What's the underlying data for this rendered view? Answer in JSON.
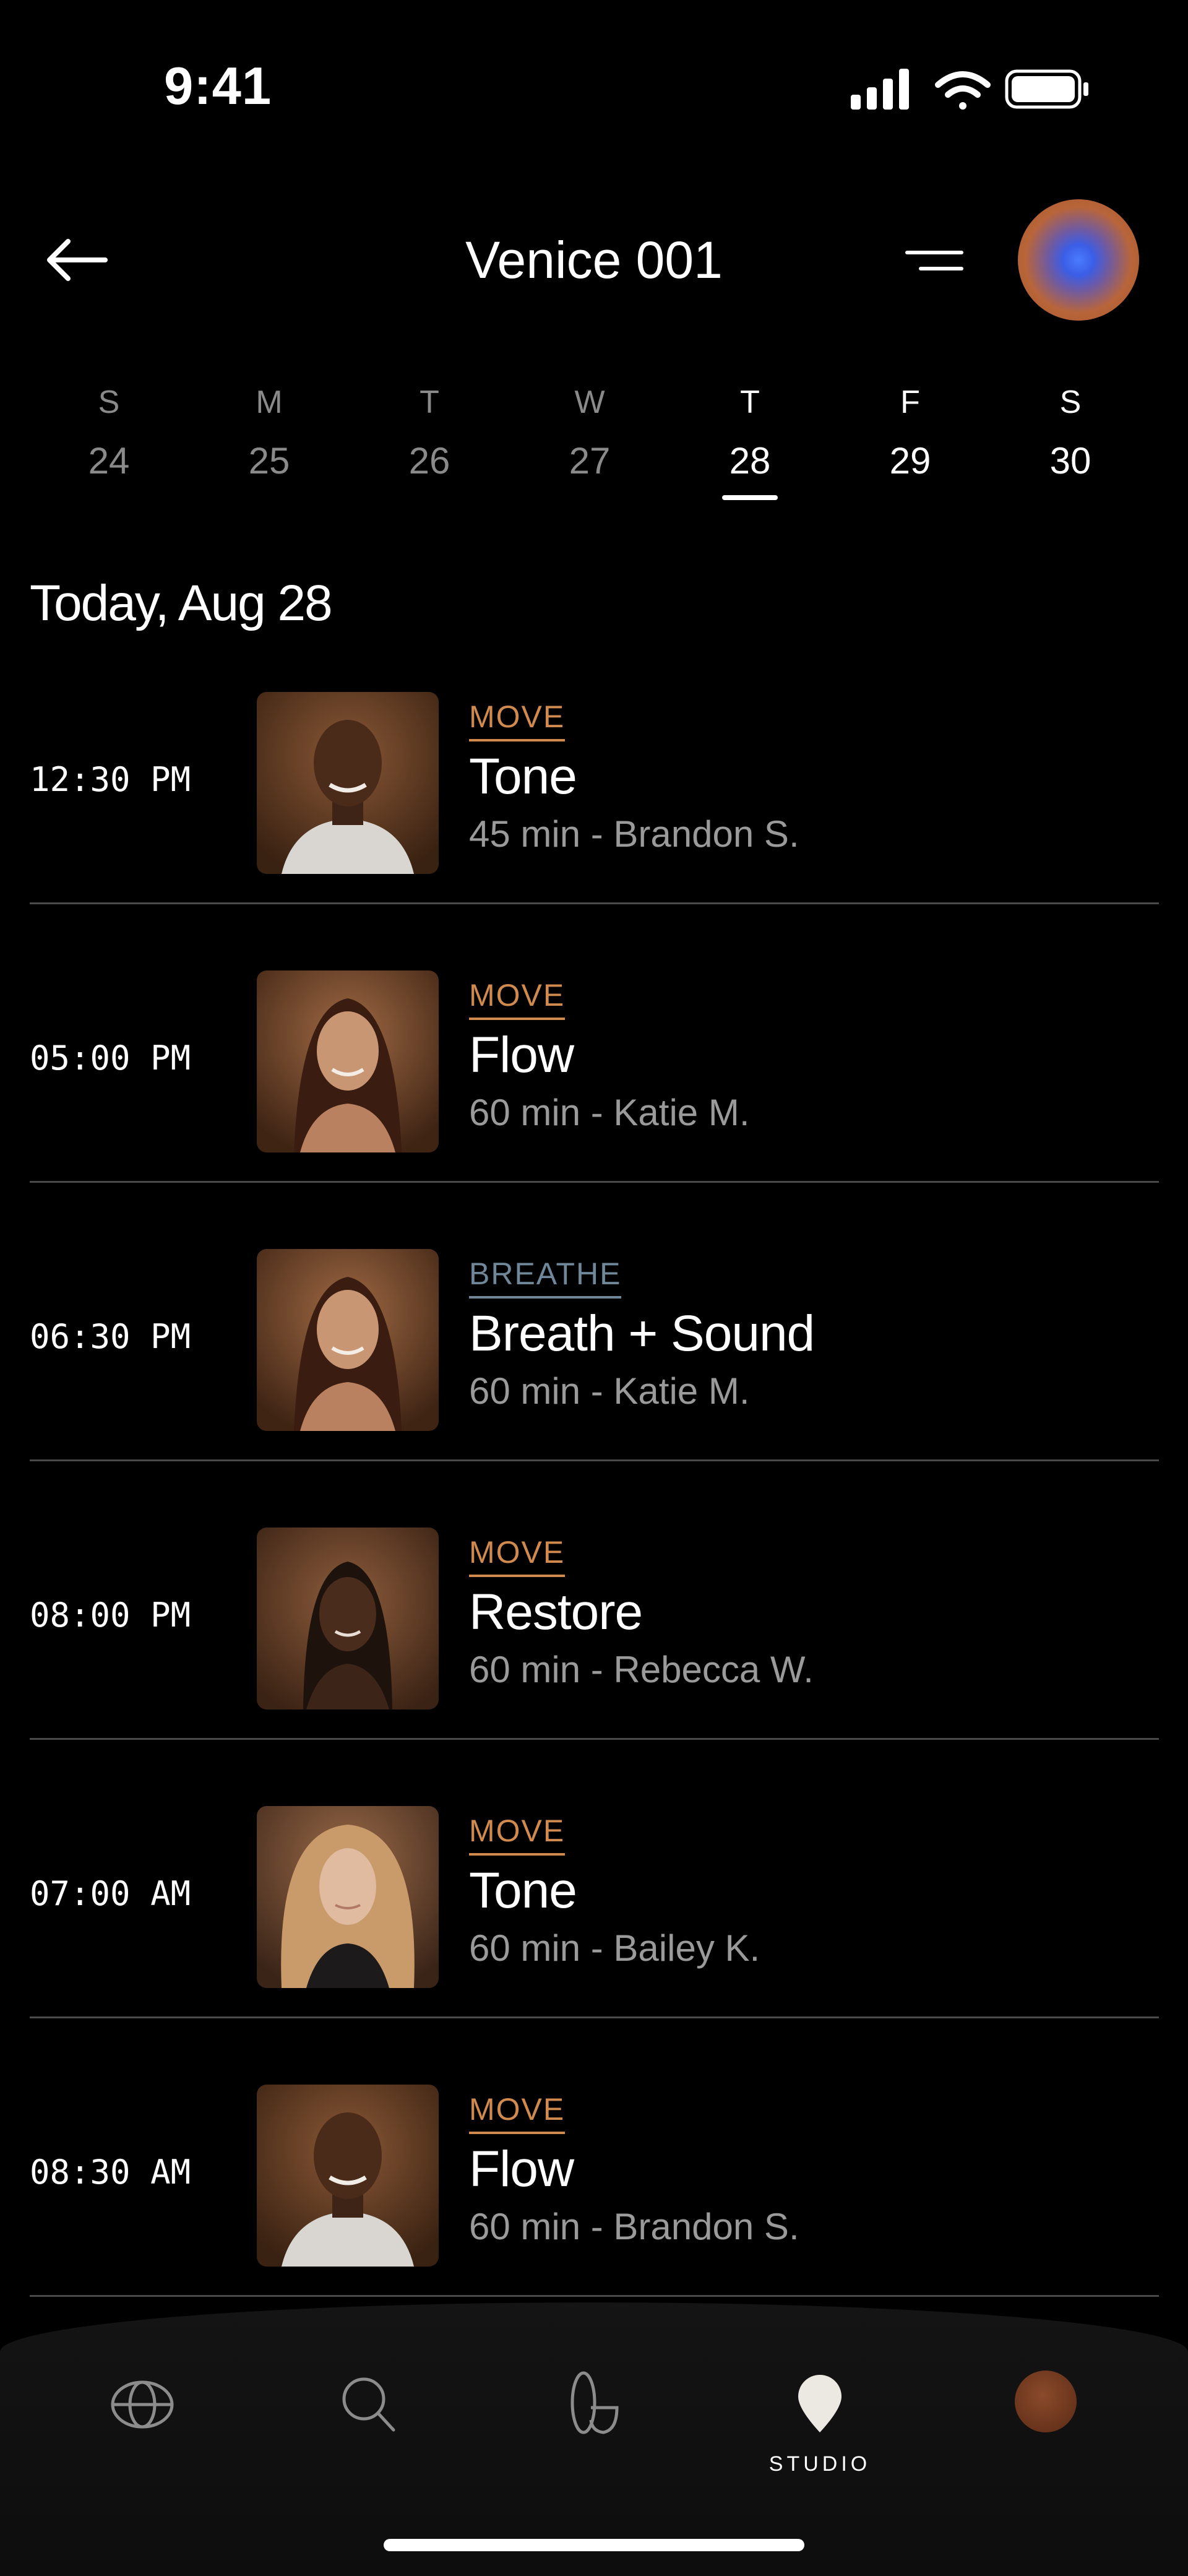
{
  "status_bar": {
    "time": "9:41",
    "icons": [
      "cellular-signal-icon",
      "wifi-icon",
      "battery-icon"
    ]
  },
  "header": {
    "title": "Venice 001",
    "back_icon": "arrow-left-icon",
    "filter_icon": "filter-lines-icon"
  },
  "week": {
    "days": [
      {
        "letter": "S",
        "date": "24",
        "state": "past"
      },
      {
        "letter": "M",
        "date": "25",
        "state": "past"
      },
      {
        "letter": "T",
        "date": "26",
        "state": "past"
      },
      {
        "letter": "W",
        "date": "27",
        "state": "past"
      },
      {
        "letter": "T",
        "date": "28",
        "state": "selected"
      },
      {
        "letter": "F",
        "date": "29",
        "state": "future"
      },
      {
        "letter": "S",
        "date": "30",
        "state": "future"
      }
    ]
  },
  "date_heading": "Today, Aug 28",
  "classes": [
    {
      "time": "12:30 PM",
      "category": "MOVE",
      "name": "Tone",
      "meta": "45 min - Brandon S."
    },
    {
      "time": "05:00 PM",
      "category": "MOVE",
      "name": "Flow",
      "meta": "60 min - Katie M."
    },
    {
      "time": "06:30 PM",
      "category": "BREATHE",
      "name": "Breath + Sound",
      "meta": "60 min - Katie M."
    },
    {
      "time": "08:00 PM",
      "category": "MOVE",
      "name": "Restore",
      "meta": "60 min - Rebecca W."
    },
    {
      "time": "07:00 AM",
      "category": "MOVE",
      "name": "Tone",
      "meta": "60 min - Bailey K."
    },
    {
      "time": "08:30 AM",
      "category": "MOVE",
      "name": "Flow",
      "meta": "60 min - Brandon S."
    }
  ],
  "colors": {
    "move": "#d08a4e",
    "breathe": "#6f8798",
    "background": "#000000",
    "divider": "#4a4a4a"
  },
  "tab_bar": {
    "tabs": [
      {
        "icon": "globe-icon",
        "label": ""
      },
      {
        "icon": "search-icon",
        "label": ""
      },
      {
        "icon": "body-shape-icon",
        "label": ""
      },
      {
        "icon": "location-pin-icon",
        "label": "STUDIO"
      },
      {
        "icon": "profile-avatar-icon",
        "label": ""
      }
    ],
    "active": "STUDIO"
  }
}
